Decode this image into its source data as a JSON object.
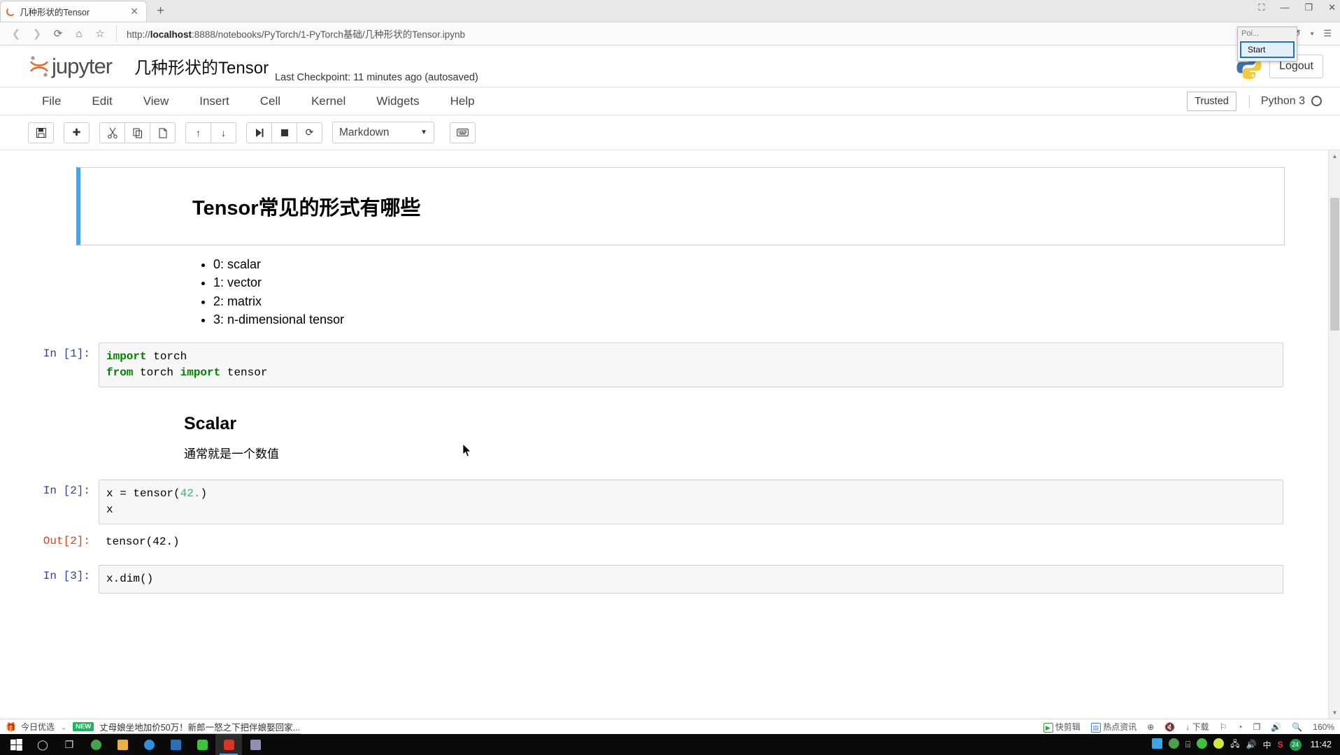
{
  "browser": {
    "tab": {
      "title": "几种形状的Tensor",
      "close_label": "✕",
      "spinner_icon": "loading-spinner-icon"
    },
    "new_tab_label": "+",
    "window_controls": {
      "skin": "⛶",
      "minimize": "—",
      "maximize": "❐",
      "close": "✕"
    },
    "nav": {
      "back": "❮",
      "forward": "❯",
      "reload": "⟳",
      "home": "⌂",
      "bookmark": "☆",
      "url_scheme": "http://",
      "url_host": "localhost",
      "url_rest": ":8888/notebooks/PyTorch/1-PyTorch基础/几种形状的Tensor.ipynb",
      "url_full": "http://localhost:8888/notebooks/PyTorch/1-PyTorch基础/几种形状的Tensor.ipynb",
      "share": "≺",
      "lightning": "⚡",
      "user": "◎",
      "undo": "↺",
      "caret": "▾",
      "menu": "☰"
    }
  },
  "popup": {
    "title": "Poi...",
    "start_button": "Start"
  },
  "jupyter": {
    "logo_text": "jupyter",
    "notebook_title": "几种形状的Tensor",
    "checkpoint": "Last Checkpoint: 11 minutes ago (autosaved)",
    "logout": "Logout",
    "trusted": "Trusted",
    "kernel_name": "Python 3",
    "menu": [
      "File",
      "Edit",
      "View",
      "Insert",
      "Cell",
      "Kernel",
      "Widgets",
      "Help"
    ],
    "toolbar": {
      "save": "💾",
      "insert": "✚",
      "cut": "✂",
      "copy": "⧉",
      "paste": "📄",
      "move_up": "↑",
      "move_down": "↓",
      "run": "▶|",
      "stop": "■",
      "restart": "⟳",
      "cell_type": "Markdown",
      "cell_type_caret": "▼",
      "command_palette": "⌨"
    }
  },
  "notebook": {
    "heading_cell": {
      "text": "Tensor常见的形式有哪些"
    },
    "bullets": [
      "0: scalar",
      "1: vector",
      "2: matrix",
      "3: n-dimensional tensor"
    ],
    "cell1": {
      "prompt": "In [1]:",
      "line1_kw": "import",
      "line1_rest": " torch",
      "line2_kw1": "from",
      "line2_mid": " torch ",
      "line2_kw2": "import",
      "line2_rest": " tensor"
    },
    "section_scalar": {
      "heading": "Scalar",
      "text": "通常就是一个数值"
    },
    "cell2": {
      "prompt": "In [2]:",
      "code_pre": "x = tensor(",
      "code_num": "42.",
      "code_post": ")\nx",
      "out_prompt": "Out[2]:",
      "out_text": "tensor(42.)"
    },
    "cell3": {
      "prompt": "In [3]:",
      "code": "x.dim()"
    }
  },
  "statusbar": {
    "left_label": "今日优选",
    "badge": "NEW",
    "headline": "丈母娘坐地加价50万！新郎一怒之下把伴娘娶回家...",
    "items": [
      "快剪辑",
      "热点资讯",
      "下载"
    ],
    "zoom": "160%",
    "chevron": "⌄"
  },
  "taskbar": {
    "clock": "11:42",
    "ime": "中",
    "badge_count": "24"
  }
}
